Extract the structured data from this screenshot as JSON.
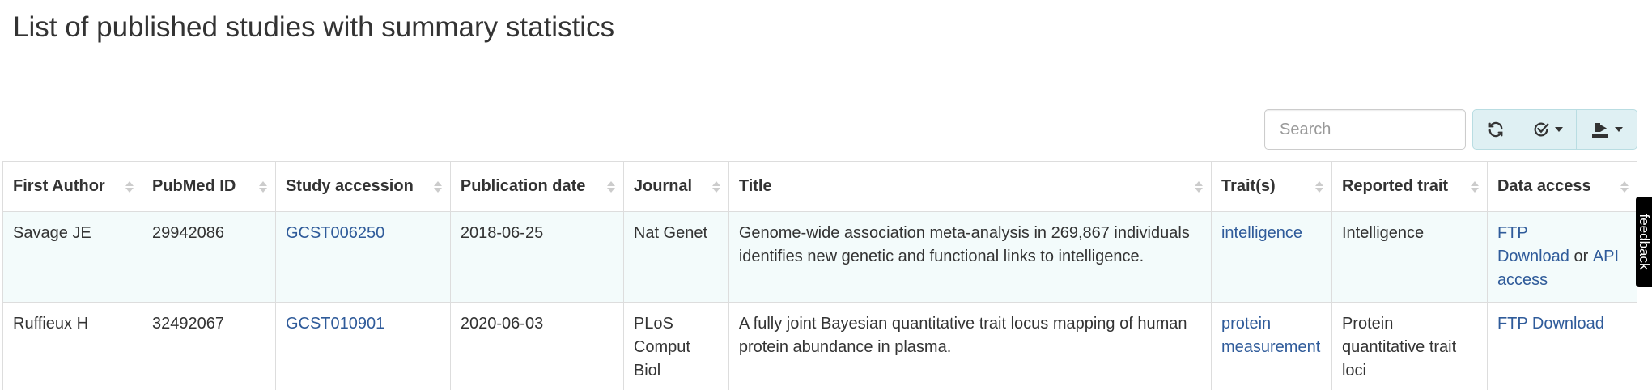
{
  "page": {
    "title": "List of published studies with summary statistics"
  },
  "toolbar": {
    "search_placeholder": "Search",
    "refresh_icon": "refresh-icon",
    "columns_icon": "check-circle-icon",
    "export_icon": "export-icon"
  },
  "table": {
    "columns": [
      "First Author",
      "PubMed ID",
      "Study accession",
      "Publication date",
      "Journal",
      "Title",
      "Trait(s)",
      "Reported trait",
      "Data access"
    ],
    "rows": [
      {
        "first_author": "Savage JE",
        "pubmed_id": "29942086",
        "study_accession": "GCST006250",
        "publication_date": "2018-06-25",
        "journal": "Nat Genet",
        "title": "Genome-wide association meta-analysis in 269,867 individuals identifies new genetic and functional links to intelligence.",
        "traits": "intelligence",
        "reported_trait": "Intelligence",
        "data_access": {
          "ftp": "FTP Download",
          "or": "or",
          "api": "API access"
        }
      },
      {
        "first_author": "Ruffieux H",
        "pubmed_id": "32492067",
        "study_accession": "GCST010901",
        "publication_date": "2020-06-03",
        "journal": "PLoS Comput Biol",
        "title": "A fully joint Bayesian quantitative trait locus mapping of human protein abundance in plasma.",
        "traits": "protein measurement",
        "reported_trait": "Protein quantitative trait loci",
        "data_access": {
          "ftp": "FTP Download"
        }
      }
    ]
  },
  "feedback": {
    "label": "feedback"
  },
  "colors": {
    "link": "#2f5b9a",
    "button_bg": "#dff0f3",
    "row_stripe": "#f3fbfb"
  }
}
